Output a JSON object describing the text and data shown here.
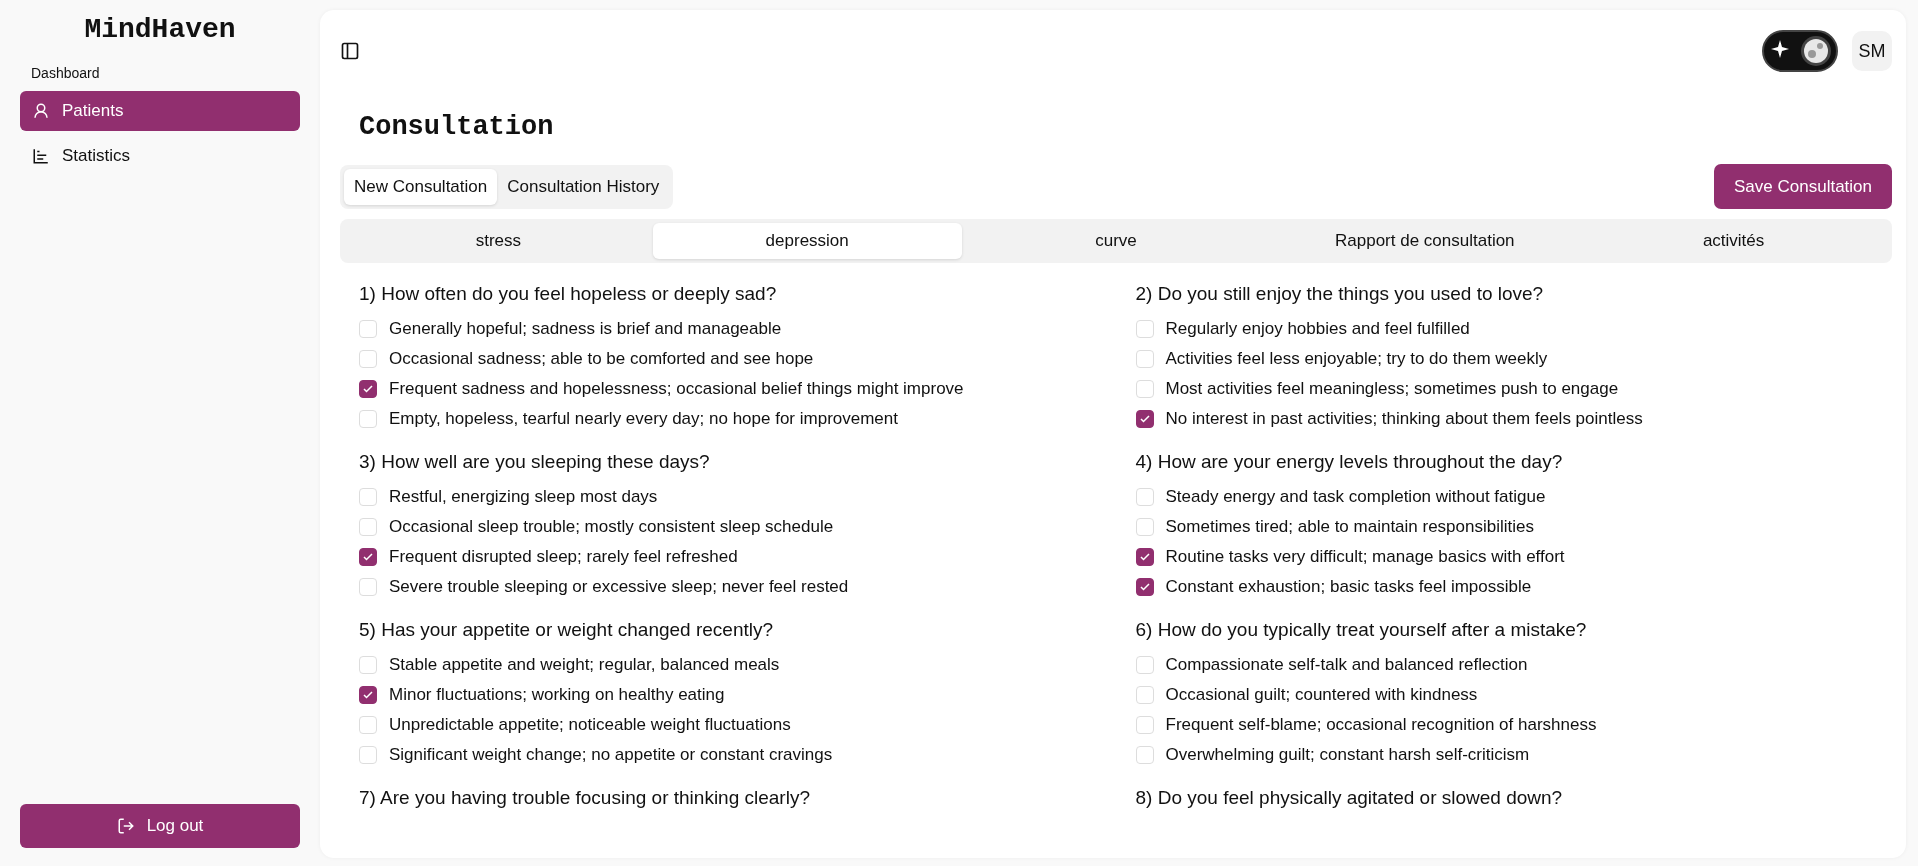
{
  "sidebar": {
    "brand": "MindHaven",
    "section": "Dashboard",
    "items": [
      {
        "label": "Patients",
        "selected": true
      },
      {
        "label": "Statistics",
        "selected": false
      }
    ],
    "logout": "Log out"
  },
  "header": {
    "dark_mode": true,
    "avatar": "SM"
  },
  "page_title": "Consultation",
  "tabs": [
    {
      "label": "New Consultation",
      "selected": true
    },
    {
      "label": "Consultation History",
      "selected": false
    }
  ],
  "save_button": "Save Consultation",
  "sections": [
    {
      "label": "stress",
      "selected": false
    },
    {
      "label": "depression",
      "selected": true
    },
    {
      "label": "curve",
      "selected": false
    },
    {
      "label": "Rapport de consultation",
      "selected": false
    },
    {
      "label": "activités",
      "selected": false
    }
  ],
  "questions": [
    {
      "title": "1) How often do you feel hopeless or deeply sad?",
      "options": [
        {
          "label": "Generally hopeful; sadness is brief and manageable",
          "checked": false
        },
        {
          "label": "Occasional sadness; able to be comforted and see hope",
          "checked": false
        },
        {
          "label": "Frequent sadness and hopelessness; occasional belief things might improve",
          "checked": true
        },
        {
          "label": "Empty, hopeless, tearful nearly every day; no hope for improvement",
          "checked": false
        }
      ]
    },
    {
      "title": "2) Do you still enjoy the things you used to love?",
      "options": [
        {
          "label": "Regularly enjoy hobbies and feel fulfilled",
          "checked": false
        },
        {
          "label": "Activities feel less enjoyable; try to do them weekly",
          "checked": false
        },
        {
          "label": "Most activities feel meaningless; sometimes push to engage",
          "checked": false
        },
        {
          "label": "No interest in past activities; thinking about them feels pointless",
          "checked": true
        }
      ]
    },
    {
      "title": "3) How well are you sleeping these days?",
      "options": [
        {
          "label": "Restful, energizing sleep most days",
          "checked": false
        },
        {
          "label": "Occasional sleep trouble; mostly consistent sleep schedule",
          "checked": false
        },
        {
          "label": "Frequent disrupted sleep; rarely feel refreshed",
          "checked": true
        },
        {
          "label": "Severe trouble sleeping or excessive sleep; never feel rested",
          "checked": false
        }
      ]
    },
    {
      "title": "4) How are your energy levels throughout the day?",
      "options": [
        {
          "label": "Steady energy and task completion without fatigue",
          "checked": false
        },
        {
          "label": "Sometimes tired; able to maintain responsibilities",
          "checked": false
        },
        {
          "label": "Routine tasks very difficult; manage basics with effort",
          "checked": true
        },
        {
          "label": "Constant exhaustion; basic tasks feel impossible",
          "checked": true
        }
      ]
    },
    {
      "title": "5) Has your appetite or weight changed recently?",
      "options": [
        {
          "label": "Stable appetite and weight; regular, balanced meals",
          "checked": false
        },
        {
          "label": "Minor fluctuations; working on healthy eating",
          "checked": true
        },
        {
          "label": "Unpredictable appetite; noticeable weight fluctuations",
          "checked": false
        },
        {
          "label": "Significant weight change; no appetite or constant cravings",
          "checked": false
        }
      ]
    },
    {
      "title": "6) How do you typically treat yourself after a mistake?",
      "options": [
        {
          "label": "Compassionate self-talk and balanced reflection",
          "checked": false
        },
        {
          "label": "Occasional guilt; countered with kindness",
          "checked": false
        },
        {
          "label": "Frequent self-blame; occasional recognition of harshness",
          "checked": false
        },
        {
          "label": "Overwhelming guilt; constant harsh self-criticism",
          "checked": false
        }
      ]
    },
    {
      "title": "7) Are you having trouble focusing or thinking clearly?"
    },
    {
      "title": "8) Do you feel physically agitated or slowed down?"
    }
  ]
}
